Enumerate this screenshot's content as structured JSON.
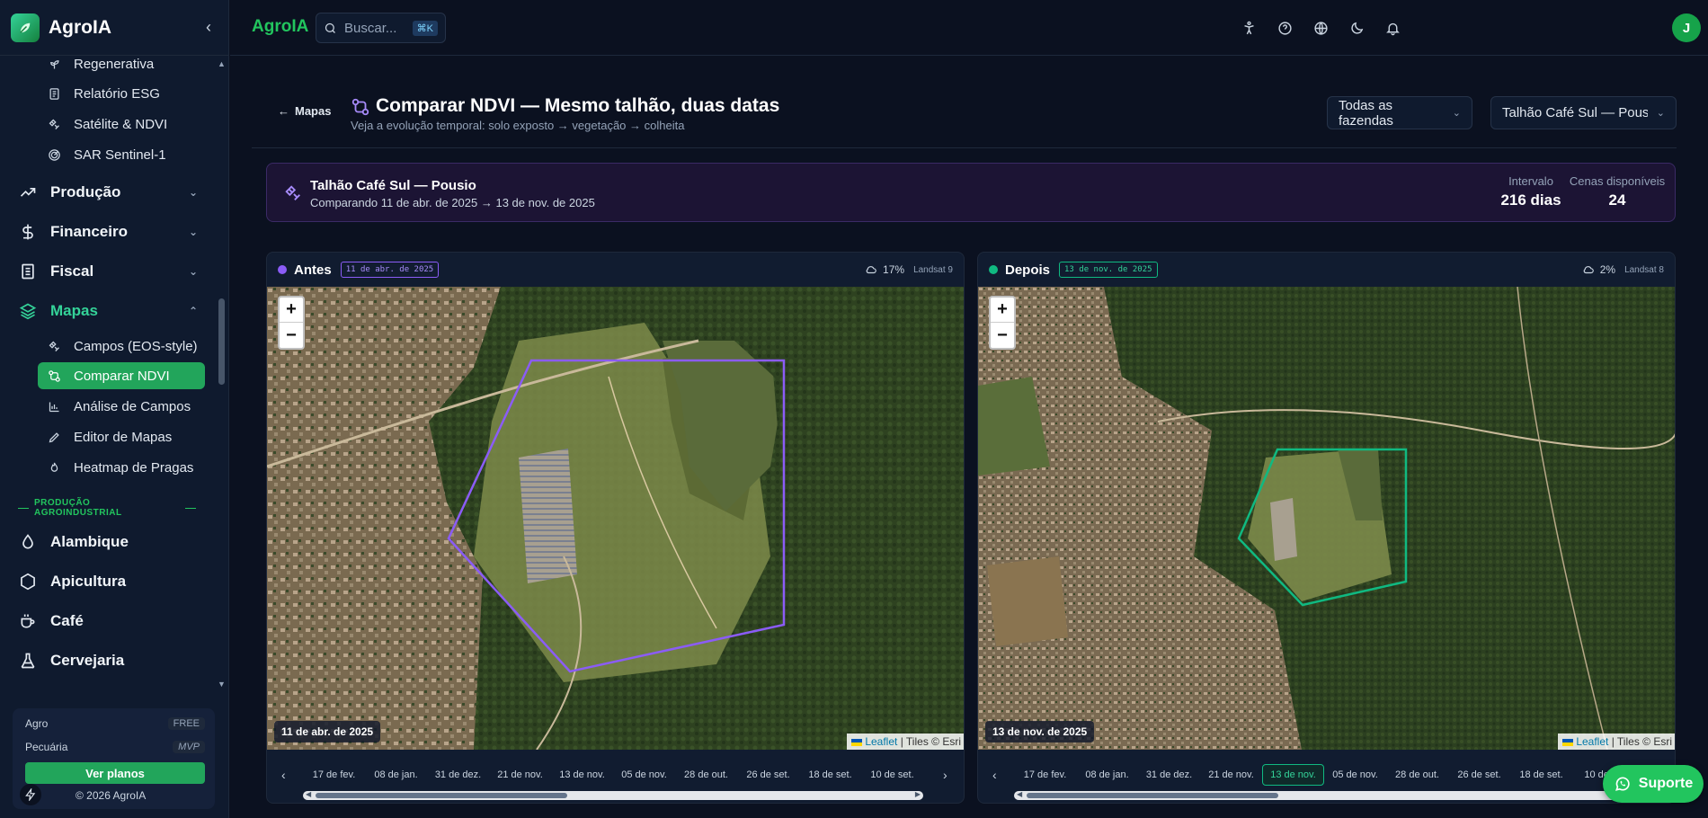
{
  "app": {
    "name": "AgroIA",
    "brand_top": "AgroIA"
  },
  "search": {
    "placeholder": "Buscar...",
    "shortcut": "⌘K"
  },
  "user": {
    "initial": "J"
  },
  "sidebar": {
    "sub_items_top": [
      {
        "label": "Regenerativa",
        "icon": "sprout-icon"
      },
      {
        "label": "Relatório ESG",
        "icon": "report-icon"
      },
      {
        "label": "Satélite & NDVI",
        "icon": "satellite-icon"
      },
      {
        "label": "SAR Sentinel-1",
        "icon": "radar-icon"
      }
    ],
    "groups": [
      {
        "label": "Produção",
        "icon": "trending-icon"
      },
      {
        "label": "Financeiro",
        "icon": "dollar-icon"
      },
      {
        "label": "Fiscal",
        "icon": "receipt-icon"
      },
      {
        "label": "Mapas",
        "icon": "layers-icon"
      }
    ],
    "map_items": [
      {
        "label": "Campos (EOS-style)",
        "icon": "satellite-icon"
      },
      {
        "label": "Comparar NDVI",
        "icon": "compare-icon"
      },
      {
        "label": "Análise de Campos",
        "icon": "bar-chart-icon"
      },
      {
        "label": "Editor de Mapas",
        "icon": "pen-icon"
      },
      {
        "label": "Heatmap de Pragas",
        "icon": "flame-icon"
      }
    ],
    "section_label": "PRODUÇÃO AGROINDUSTRIAL",
    "agro_items": [
      {
        "label": "Alambique",
        "icon": "drop-icon"
      },
      {
        "label": "Apicultura",
        "icon": "hexagon-icon"
      },
      {
        "label": "Café",
        "icon": "coffee-icon"
      },
      {
        "label": "Cervejaria",
        "icon": "flask-icon"
      }
    ],
    "plans": [
      {
        "name": "Agro",
        "badge": "FREE"
      },
      {
        "name": "Pecuária",
        "badge": "MVP"
      }
    ],
    "plans_button": "Ver planos",
    "copyright": "© 2026 AgroIA"
  },
  "header": {
    "back_label": "Mapas",
    "title": "Comparar NDVI — Mesmo talhão, duas datas",
    "subtitle": "Veja a evolução temporal: solo exposto → vegetação → colheita",
    "farm_select": "Todas as fazendas",
    "field_select": "Talhão Café Sul — Pousio"
  },
  "banner": {
    "title": "Talhão Café Sul — Pousio",
    "subtitle": "Comparando 11 de abr. de 2025 → 13 de nov. de 2025",
    "interval_label": "Intervalo",
    "interval_value": "216 dias",
    "scenes_label": "Cenas disponíveis",
    "scenes_value": "24"
  },
  "panels": {
    "before": {
      "name": "Antes",
      "date_tag": "11 de abr. de 2025",
      "cloud": "17%",
      "satellite": "Landsat 9",
      "map_date": "11 de abr. de 2025",
      "color": "#8b5cf6",
      "timeline": [
        "17 de fev.",
        "08 de jan.",
        "31 de dez.",
        "21 de nov.",
        "13 de nov.",
        "05 de nov.",
        "28 de out.",
        "26 de set.",
        "18 de set.",
        "10 de set."
      ]
    },
    "after": {
      "name": "Depois",
      "date_tag": "13 de nov. de 2025",
      "cloud": "2%",
      "satellite": "Landsat 8",
      "map_date": "13 de nov. de 2025",
      "color": "#10b981",
      "timeline": [
        "17 de fev.",
        "08 de jan.",
        "31 de dez.",
        "21 de nov.",
        "13 de nov.",
        "05 de nov.",
        "28 de out.",
        "26 de set.",
        "18 de set.",
        "10 de se"
      ],
      "selected_index": 4
    }
  },
  "map_attribution": {
    "leaflet": "Leaflet",
    "tiles": "| Tiles © Esri"
  },
  "support": {
    "label": "Suporte"
  },
  "colors": {
    "accent": "#22c55e",
    "active": "#22a55b",
    "purple": "#8b5cf6",
    "teal": "#10b981"
  }
}
